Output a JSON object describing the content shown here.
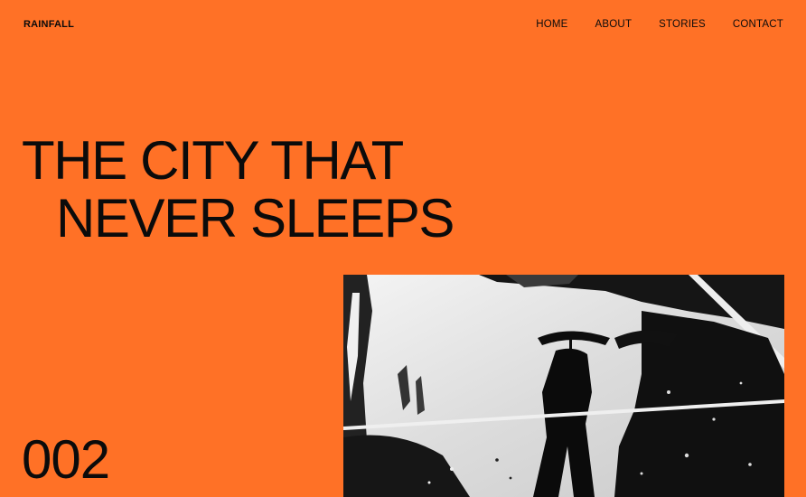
{
  "brand": "RAINFALL",
  "nav": {
    "items": [
      "HOME",
      "ABOUT",
      "STORIES",
      "CONTACT"
    ]
  },
  "hero": {
    "line1": "THE CITY THAT",
    "line2": "NEVER SLEEPS"
  },
  "issue_number": "002",
  "colors": {
    "background": "#FF7126",
    "text": "#0b0b0b"
  },
  "photo": {
    "description_icon": "rain-reflection-photo"
  }
}
